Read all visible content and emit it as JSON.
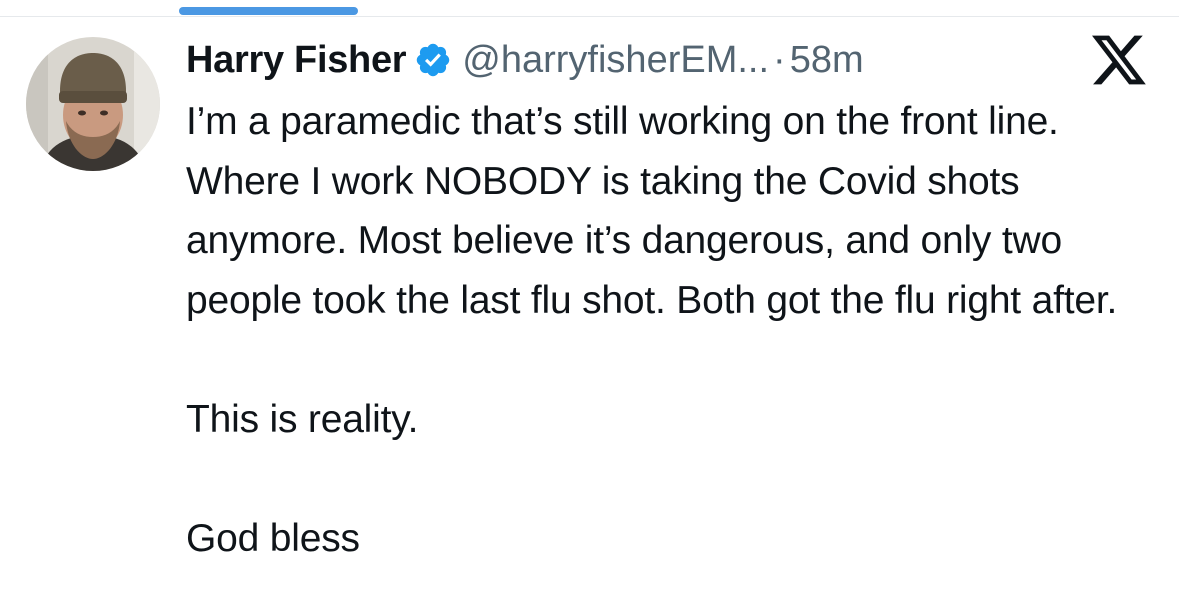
{
  "tweet": {
    "author": {
      "name": "Harry Fisher",
      "handle": "@harryfisherEM...",
      "verified": true,
      "avatar_icon": "profile-photo-bearded-man-beanie"
    },
    "separator": "·",
    "time": "58m",
    "platform_icon": "x-logo-icon",
    "paragraphs": [
      "I’m a paramedic that’s still working on the front line. Where I work NOBODY is taking the Covid shots anymore. Most believe it’s dangerous, and only two people took the last flu shot. Both got the flu right after.",
      "This is reality.",
      "God bless"
    ]
  },
  "colors": {
    "text": "#0f1419",
    "secondary_text": "#536471",
    "verified_badge": "#1d9bf0",
    "tab_indicator": "#4b98e3"
  }
}
